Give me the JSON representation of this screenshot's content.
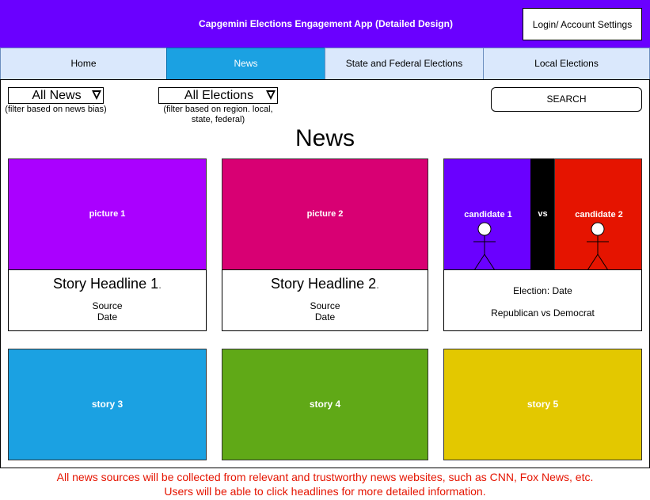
{
  "header": {
    "title": "Capgemini Elections Engagement App (Detailed Design)",
    "login_label": "Login/ Account Settings"
  },
  "nav": {
    "tabs": [
      {
        "label": "Home",
        "active": false
      },
      {
        "label": "News",
        "active": true
      },
      {
        "label": "State and Federal Elections",
        "active": false
      },
      {
        "label": "Local Elections",
        "active": false
      }
    ]
  },
  "filters": {
    "news": {
      "value": "All News",
      "hint": "(filter based on news bias)"
    },
    "elections": {
      "value": "All Elections",
      "hint": "(filter based on region. local, state, federal)"
    }
  },
  "search": {
    "label": "SEARCH"
  },
  "page": {
    "title": "News"
  },
  "cards": [
    {
      "image_label": "picture 1",
      "headline": "Story Headline 1",
      "source": "Source",
      "date": "Date",
      "color": "#aa00ff"
    },
    {
      "image_label": "picture 2",
      "headline": "Story Headline 2",
      "source": "Source",
      "date": "Date",
      "color": "#d80073"
    }
  ],
  "election_card": {
    "candidate1": "candidate 1",
    "vs": "vs",
    "candidate2": "candidate 2",
    "date_line": "Election: Date",
    "parties": "Republican vs Democrat",
    "colors": {
      "candidate1": "#6a00ff",
      "divider": "#000000",
      "candidate2": "#e51400"
    }
  },
  "stories": [
    {
      "label": "story 3",
      "color": "#1ba1e2"
    },
    {
      "label": "story 4",
      "color": "#60a917"
    },
    {
      "label": "story 5",
      "color": "#e3c800"
    }
  ],
  "footer": {
    "line1": "All news sources will be collected from relevant and trustworthy news websites, such as CNN, Fox News, etc.",
    "line2": "Users will be able to click headlines for more detailed information."
  }
}
